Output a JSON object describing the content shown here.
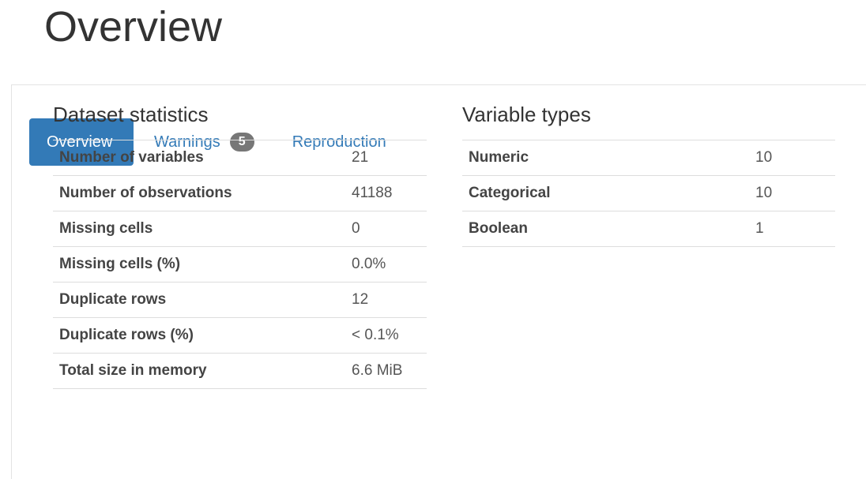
{
  "page": {
    "title": "Overview"
  },
  "tabs": [
    {
      "label": "Overview",
      "active": true
    },
    {
      "label": "Warnings",
      "badge": "5",
      "active": false
    },
    {
      "label": "Reproduction",
      "active": false
    }
  ],
  "dataset_statistics": {
    "heading": "Dataset statistics",
    "rows": [
      {
        "label": "Number of variables",
        "value": "21"
      },
      {
        "label": "Number of observations",
        "value": "41188"
      },
      {
        "label": "Missing cells",
        "value": "0"
      },
      {
        "label": "Missing cells (%)",
        "value": "0.0%"
      },
      {
        "label": "Duplicate rows",
        "value": "12"
      },
      {
        "label": "Duplicate rows (%)",
        "value": "< 0.1%"
      },
      {
        "label": "Total size in memory",
        "value": "6.6 MiB"
      }
    ]
  },
  "variable_types": {
    "heading": "Variable types",
    "rows": [
      {
        "label": "Numeric",
        "value": "10"
      },
      {
        "label": "Categorical",
        "value": "10"
      },
      {
        "label": "Boolean",
        "value": "1"
      }
    ]
  },
  "colors": {
    "accent": "#337ab7",
    "badge": "#777777",
    "text": "#333333",
    "border": "#dddddd"
  }
}
